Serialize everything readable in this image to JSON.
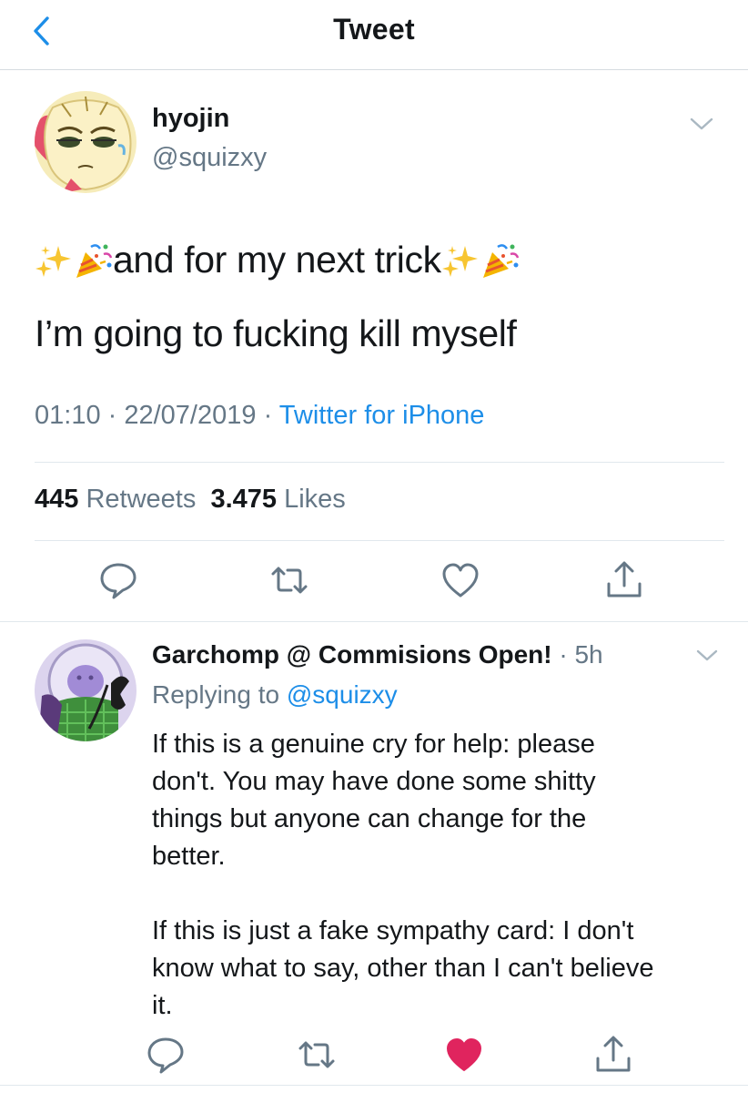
{
  "header": {
    "title": "Tweet"
  },
  "tweet": {
    "name": "hyojin",
    "handle": "@squizxy",
    "line1_text": "and for my next trick",
    "line2_text": "I’m going to fucking kill myself",
    "time": "01:10",
    "date": "22/07/2019",
    "source": "Twitter for iPhone",
    "retweet_count": "445",
    "retweets_label": "Retweets",
    "like_count": "3.475",
    "likes_label": "Likes"
  },
  "reply": {
    "name": "Garchomp @ Commisions Open!",
    "time": "5h",
    "replying_prefix": "Replying to",
    "replying_handle": "@squizxy",
    "body_lines": [
      "If this is a genuine cry for help: please",
      "don't. You may have done some shitty",
      "things but anyone can change for the",
      "better.",
      "If this is just a fake sympathy card: I don't",
      "know what to say, other than I can't believe",
      "it."
    ],
    "liked": true
  },
  "colors": {
    "accent": "#1d8ee8",
    "secondary_text": "#657786",
    "icon_gray": "#657786",
    "like_red": "#e0245e"
  },
  "icons": {
    "back": "chevron-left-icon",
    "menu": "chevron-down-icon",
    "reply": "reply-bubble-icon",
    "retweet": "retweet-icon",
    "like": "heart-icon",
    "share": "share-icon",
    "emoji1": "sparkles-emoji",
    "emoji2": "party-popper-emoji"
  }
}
